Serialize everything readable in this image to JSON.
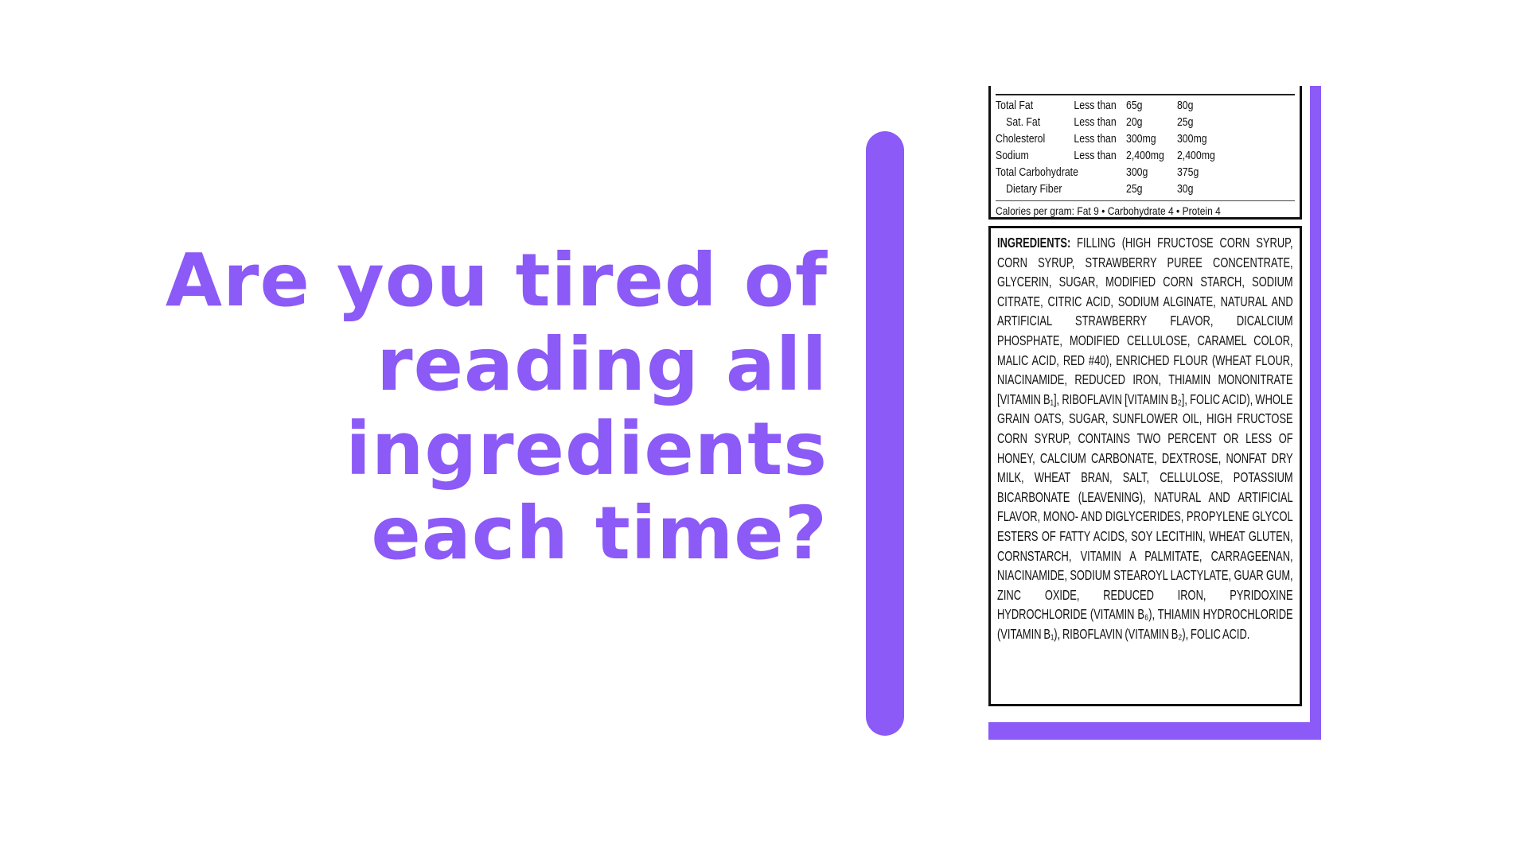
{
  "headline": {
    "lines": [
      "Are you tired of",
      "reading all",
      "ingredients",
      "each time?"
    ]
  },
  "colors": {
    "accent": "#8c5af6",
    "text": "#111111",
    "background": "#ffffff"
  },
  "label": {
    "table": {
      "rows": [
        {
          "name": "Total Fat",
          "qualifier": "Less than",
          "v1": "65g",
          "v2": "80g"
        },
        {
          "name": "Sat. Fat",
          "qualifier": "Less than",
          "v1": "20g",
          "v2": "25g"
        },
        {
          "name": "Cholesterol",
          "qualifier": "Less than",
          "v1": "300mg",
          "v2": "300mg"
        },
        {
          "name": "Sodium",
          "qualifier": "Less than",
          "v1": "2,400mg",
          "v2": "2,400mg"
        },
        {
          "name": "Total Carbohydrate",
          "qualifier": "",
          "v1": "300g",
          "v2": "375g"
        },
        {
          "name": "Dietary Fiber",
          "qualifier": "",
          "v1": "25g",
          "v2": "30g"
        }
      ]
    },
    "calories_per_gram": "Calories per gram: Fat 9 • Carbohydrate 4 • Protein 4",
    "ingredients_heading": "INGREDIENTS:",
    "ingredients_text": "FILLING (HIGH FRUCTOSE CORN SYRUP, CORN SYRUP, STRAWBERRY PUREE CONCENTRATE, GLYCERIN, SUGAR, MODIFIED CORN STARCH, SODIUM CITRATE, CITRIC ACID, SODIUM ALGINATE, NATURAL AND ARTIFICIAL STRAWBERRY FLAVOR, DICALCIUM PHOSPHATE, MODIFIED CELLULOSE, CARAMEL COLOR, MALIC ACID, RED #40), ENRICHED FLOUR (WHEAT FLOUR, NIACINAMIDE, REDUCED IRON, THIAMIN MONONITRATE [VITAMIN B₁], RIBOFLAVIN [VITAMIN B₂], FOLIC ACID), WHOLE GRAIN OATS, SUGAR, SUNFLOWER OIL, HIGH FRUCTOSE CORN SYRUP, CONTAINS TWO PERCENT OR LESS OF HONEY, CALCIUM CARBONATE, DEXTROSE, NONFAT DRY MILK, WHEAT BRAN, SALT, CELLULOSE, POTASSIUM BICARBONATE (LEAVENING), NATURAL AND ARTIFICIAL FLAVOR, MONO- AND DIGLYCERIDES, PROPYLENE GLYCOL ESTERS OF FATTY ACIDS, SOY LECITHIN, WHEAT GLUTEN, CORNSTARCH, VITAMIN A PALMITATE, CARRAGEENAN, NIACINAMIDE, SODIUM STEAROYL LACTYLATE, GUAR GUM, ZINC OXIDE, REDUCED IRON, PYRIDOXINE HYDROCHLORIDE (VITAMIN B₆), THIAMIN HYDROCHLORIDE (VITAMIN B₁), RIBOFLAVIN (VITAMIN B₂), FOLIC ACID."
  }
}
